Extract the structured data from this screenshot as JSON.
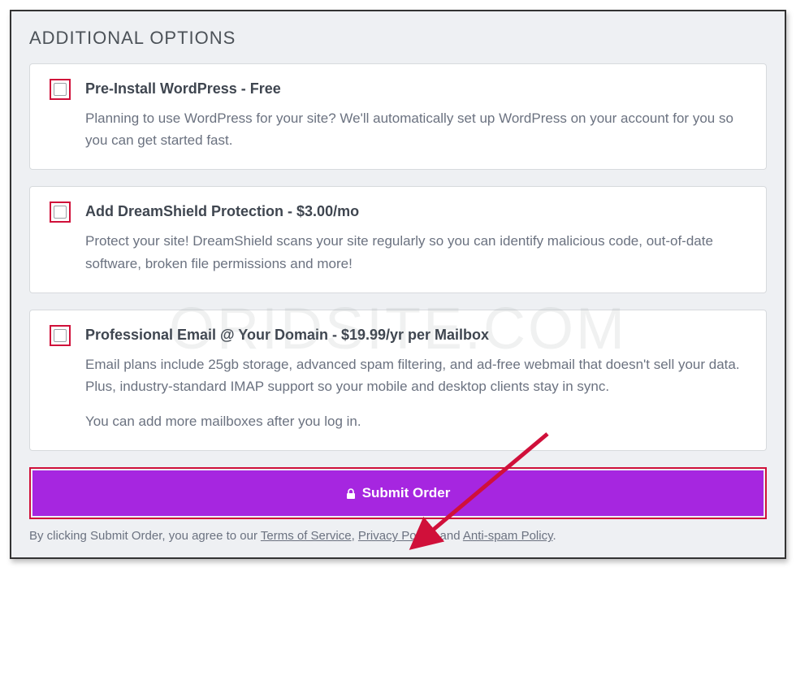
{
  "section_title": "ADDITIONAL OPTIONS",
  "options": [
    {
      "title": "Pre-Install WordPress - Free",
      "description": "Planning to use WordPress for your site? We'll automatically set up WordPress on your account for you so you can get started fast.",
      "extra": null
    },
    {
      "title": "Add DreamShield Protection - $3.00/mo",
      "description": "Protect your site! DreamShield scans your site regularly so you can identify malicious code, out-of-date software, broken file permissions and more!",
      "extra": null
    },
    {
      "title": "Professional Email @ Your Domain - $19.99/yr per Mailbox",
      "description": "Email plans include 25gb storage, advanced spam filtering, and ad-free webmail that doesn't sell your data. Plus, industry-standard IMAP support so your mobile and desktop clients stay in sync.",
      "extra": "You can add more mailboxes after you log in."
    }
  ],
  "submit_label": "Submit Order",
  "disclaimer_prefix": "By clicking Submit Order, you agree to our ",
  "terms_label": "Terms of Service",
  "privacy_label": "Privacy Policy",
  "antispam_label": "Anti-spam Policy",
  "disclaimer_sep1": ", ",
  "disclaimer_sep2": ", and ",
  "disclaimer_suffix": ".",
  "watermark": "ORIDSITE.COM"
}
